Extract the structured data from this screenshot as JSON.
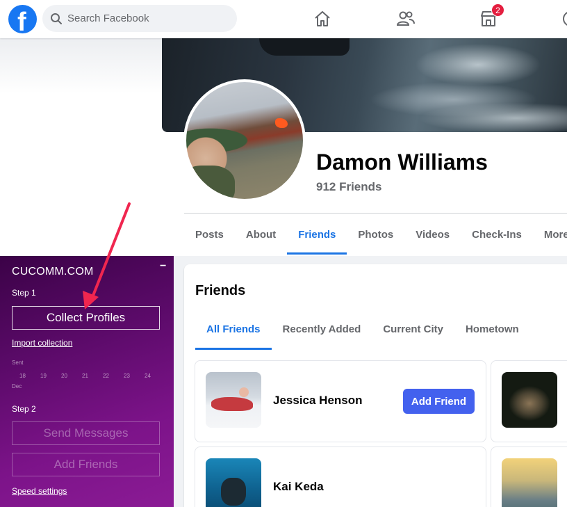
{
  "topbar": {
    "logo_letter": "f",
    "search_placeholder": "Search Facebook",
    "marketplace_badge": "2"
  },
  "profile": {
    "name": "Damon Williams",
    "friends_count": "912 Friends",
    "tabs": [
      "Posts",
      "About",
      "Friends",
      "Photos",
      "Videos",
      "Check-Ins",
      "More"
    ],
    "active_tab": "Friends"
  },
  "extension": {
    "title": "CUCOMM.COM",
    "minimize": "−",
    "step1_label": "Step 1",
    "collect_button": "Collect Profiles",
    "import_link": "Import collection",
    "sent_label": "Sent",
    "dates": [
      "18",
      "19",
      "20",
      "21",
      "22",
      "23",
      "24"
    ],
    "month_label": "Dec",
    "step2_label": "Step 2",
    "send_button": "Send Messages",
    "add_button": "Add Friends",
    "speed_link": "Speed settings",
    "accent_color": "#7c1389"
  },
  "friends_section": {
    "title": "Friends",
    "tabs": [
      "All Friends",
      "Recently Added",
      "Current City",
      "Hometown"
    ],
    "active_tab": "All Friends",
    "items": [
      {
        "name": "Jessica Henson",
        "action": "Add Friend"
      },
      {
        "name": "Kai Keda"
      }
    ]
  }
}
